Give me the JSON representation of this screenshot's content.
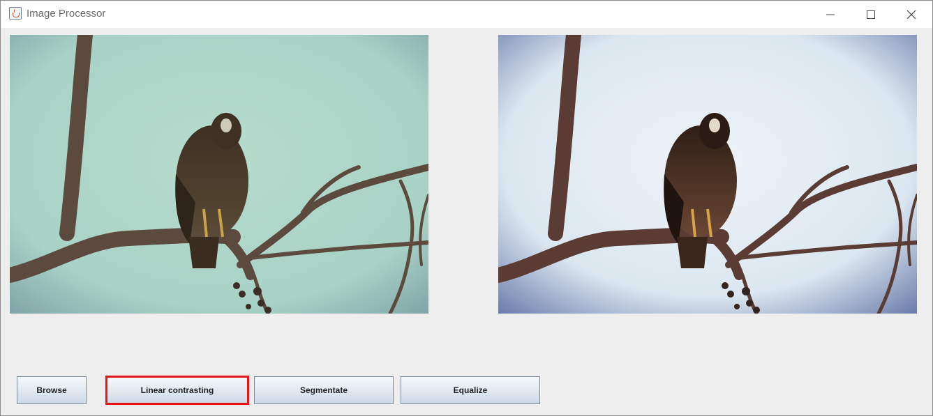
{
  "window": {
    "title": "Image Processor",
    "controls": [
      "minimize",
      "maximize",
      "close"
    ]
  },
  "images": {
    "original": {
      "subject": "hawk-on-branch",
      "tone": "teal-green sky"
    },
    "processed": {
      "subject": "hawk-on-branch",
      "tone": "pale blue sky, higher contrast"
    }
  },
  "buttons": {
    "browse": "Browse",
    "linear": "Linear contrasting",
    "segment": "Segmentate",
    "equalize": "Equalize"
  },
  "highlight": {
    "target": "linear",
    "color": "#e8141c"
  },
  "colors": {
    "window_bg": "#eeeeee",
    "titlebar_bg": "#ffffff",
    "left_sky": "#a9d5c8",
    "right_sky": "#dfe9f1"
  }
}
